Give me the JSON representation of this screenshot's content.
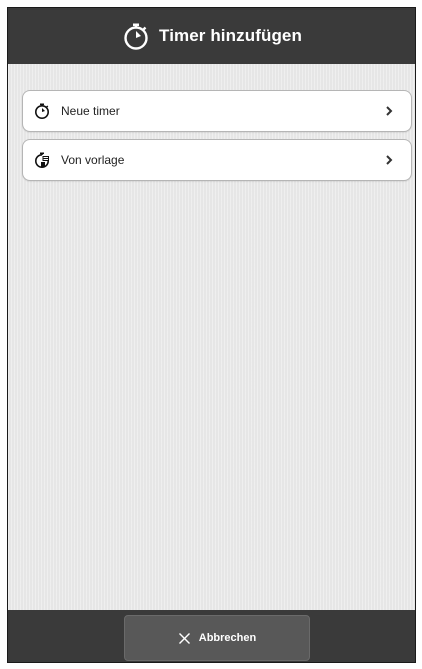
{
  "header": {
    "title": "Timer hinzufügen",
    "icon": "stopwatch-icon"
  },
  "list": {
    "items": [
      {
        "label": "Neue timer",
        "icon": "stopwatch-icon"
      },
      {
        "label": "Von vorlage",
        "icon": "template-stopwatch-icon"
      }
    ]
  },
  "footer": {
    "cancel_label": "Abbrechen",
    "cancel_icon": "close-icon"
  },
  "colors": {
    "header_bg": "#3a3a3a",
    "content_bg": "#e6e6e6",
    "button_bg": "#585858"
  }
}
